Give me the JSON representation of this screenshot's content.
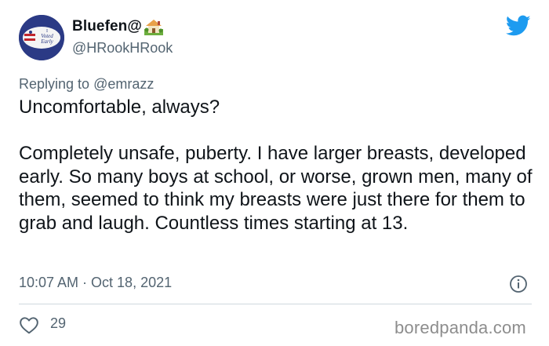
{
  "tweet": {
    "display_name": "Bluefen@",
    "handle": "@HRookHRook",
    "avatar_text": [
      "I",
      "Voted",
      "Early"
    ],
    "reply_prefix": "Replying to ",
    "reply_mention": "@emrazz",
    "text": "Uncomfortable, always?\n\nCompletely unsafe, puberty. I have larger breasts, developed early. So many boys at school, or worse, grown men, many of them, seemed to think my breasts were just there for them to grab and laugh. Countless times starting at 13.",
    "timestamp": "10:07 AM · Oct 18, 2021",
    "likes": "29"
  },
  "icons": {
    "name_emoji": "house-with-garden-icon",
    "platform": "twitter-bird-icon",
    "info": "info-icon",
    "like": "heart-icon"
  },
  "colors": {
    "twitter_blue": "#1d9bf0",
    "secondary_text": "#536471",
    "primary_text": "#0f1419"
  },
  "watermark": "boredpanda.com"
}
